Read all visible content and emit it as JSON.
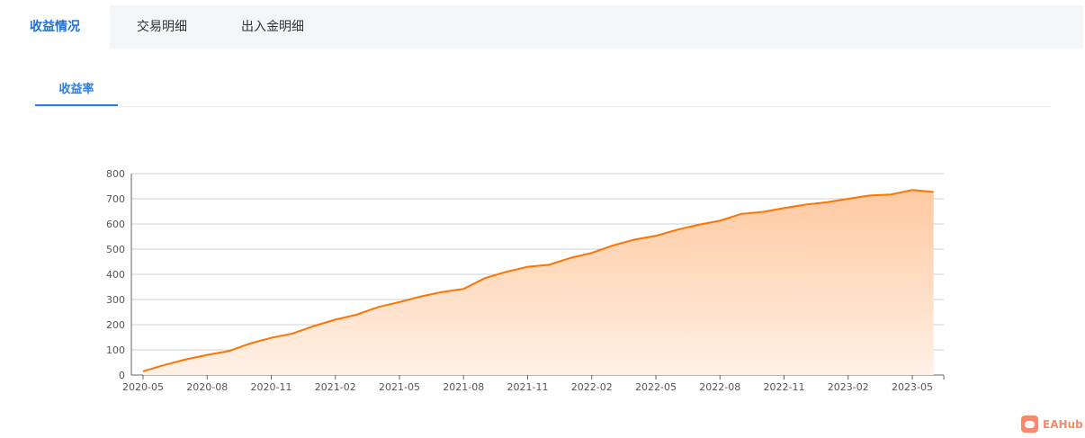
{
  "tabs": [
    {
      "label": "收益情况",
      "active": true
    },
    {
      "label": "交易明细"
    },
    {
      "label": "出入金明细"
    }
  ],
  "subtab": {
    "label": "收益率"
  },
  "logo": {
    "text": "EAHub"
  },
  "colors": {
    "accent": "#1f6fd6",
    "line": "#ff7300"
  },
  "chart_data": {
    "type": "area",
    "title": "",
    "xlabel": "",
    "ylabel": "",
    "ylim": [
      0,
      800
    ],
    "yticks": [
      0,
      100,
      200,
      300,
      400,
      500,
      600,
      700,
      800
    ],
    "xticklabels": [
      "2020-05",
      "2020-08",
      "2020-11",
      "2021-02",
      "2021-05",
      "2021-08",
      "2021-11",
      "2022-02",
      "2022-05",
      "2022-08",
      "2022-11",
      "2023-02",
      "2023-05"
    ],
    "x": [
      "2020-05",
      "2020-06",
      "2020-07",
      "2020-08",
      "2020-09",
      "2020-10",
      "2020-11",
      "2020-12",
      "2021-01",
      "2021-02",
      "2021-03",
      "2021-04",
      "2021-05",
      "2021-06",
      "2021-07",
      "2021-08",
      "2021-09",
      "2021-10",
      "2021-11",
      "2021-12",
      "2022-01",
      "2022-02",
      "2022-03",
      "2022-04",
      "2022-05",
      "2022-06",
      "2022-07",
      "2022-08",
      "2022-09",
      "2022-10",
      "2022-11",
      "2022-12",
      "2023-01",
      "2023-02",
      "2023-03",
      "2023-04",
      "2023-05",
      "2023-06"
    ],
    "series": [
      {
        "name": "收益率",
        "values": [
          15,
          40,
          62,
          80,
          95,
          125,
          148,
          165,
          195,
          220,
          240,
          270,
          290,
          312,
          330,
          342,
          385,
          410,
          430,
          438,
          465,
          485,
          515,
          538,
          553,
          577,
          597,
          613,
          640,
          648,
          663,
          677,
          686,
          700,
          713,
          717,
          735,
          727
        ]
      }
    ],
    "grid": true
  }
}
